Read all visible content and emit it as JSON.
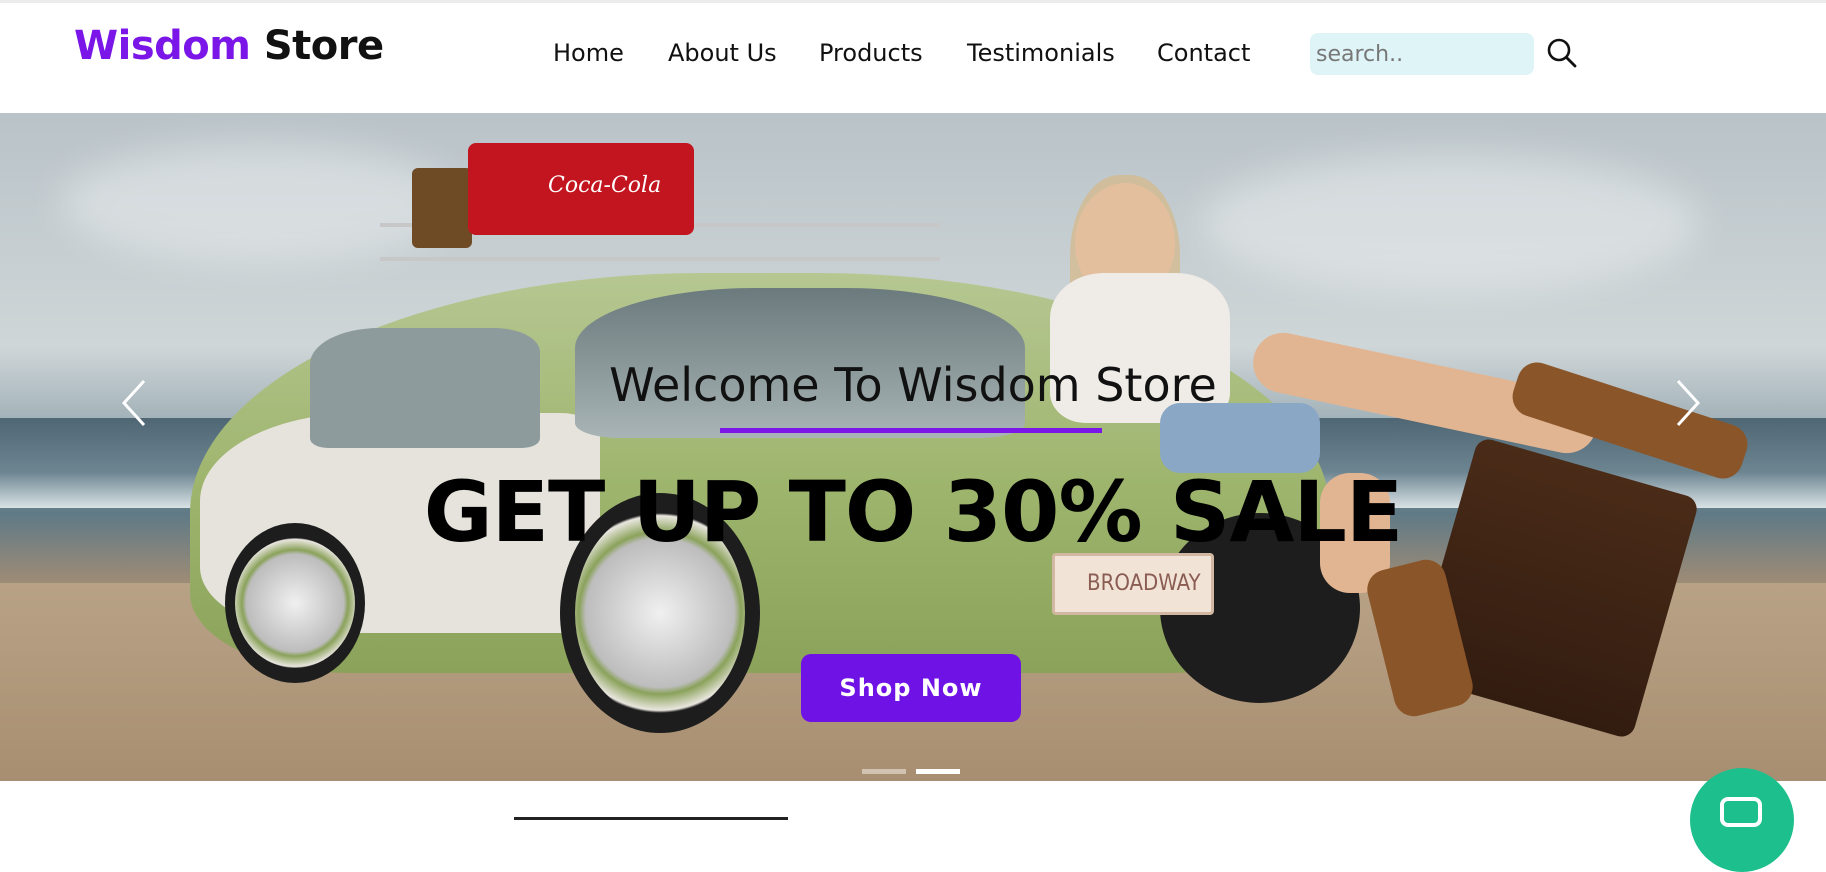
{
  "header": {
    "logo": {
      "part1": "Wisdom",
      "part2": "Store"
    },
    "nav": [
      "Home",
      "About Us",
      "Products",
      "Testimonials",
      "Contact"
    ],
    "search": {
      "placeholder": "search..",
      "value": "",
      "icon": "search-icon"
    }
  },
  "hero": {
    "welcome": "Welcome To Wisdom Store",
    "headline": "GET UP TO 30% SALE",
    "cta_label": "Shop Now",
    "image_texts": {
      "cooler": "Coca-Cola",
      "plate": "BROADWAY"
    },
    "slide_count": 2,
    "active_slide": 2,
    "prev_icon": "chevron-left-icon",
    "next_icon": "chevron-right-icon"
  },
  "colors": {
    "brand": "#7a16e8",
    "cta": "#6f12e6",
    "search_bg": "#dff4f7",
    "chat": "#1dbf8c"
  },
  "chat": {
    "icon": "chat-icon"
  }
}
